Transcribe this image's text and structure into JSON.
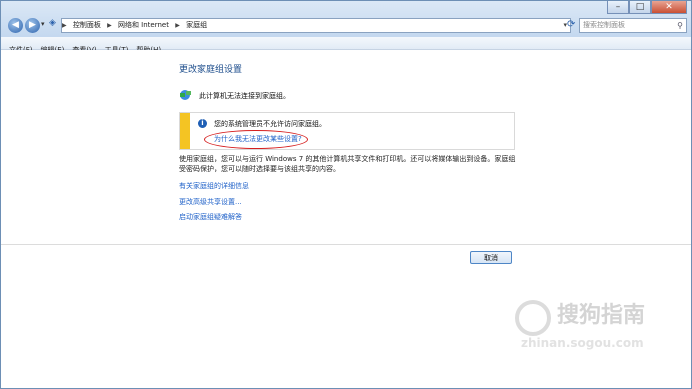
{
  "breadcrumb": [
    "控制面板",
    "网络和 Internet",
    "家庭组"
  ],
  "search": {
    "placeholder": "搜索控制面板"
  },
  "menu": [
    "文件(F)",
    "编辑(E)",
    "查看(V)",
    "工具(T)",
    "帮助(H)"
  ],
  "page": {
    "title": "更改家庭组设置",
    "status": "此计算机无法连接到家庭组。",
    "info_text": "您的系统管理员不允许访问家庭组。",
    "info_link": "为什么我无法更改某些设置?",
    "description": "使用家庭组，您可以与运行 Windows 7 的其他计算机共享文件和打印机。还可以将媒体输出到设备。家庭组受密码保护，您可以随时选择要与该组共享的内容。",
    "links": [
      "有关家庭组的详细信息",
      "更改高级共享设置...",
      "启动家庭组疑难解答"
    ],
    "cancel": "取消"
  },
  "watermark": {
    "text": "搜狗指南",
    "sub": "zhinan.sogou.com"
  },
  "colors": {
    "accent": "#1e60c8",
    "title": "#1e4e8c",
    "warning": "#f4c423",
    "highlight": "#d62020"
  }
}
